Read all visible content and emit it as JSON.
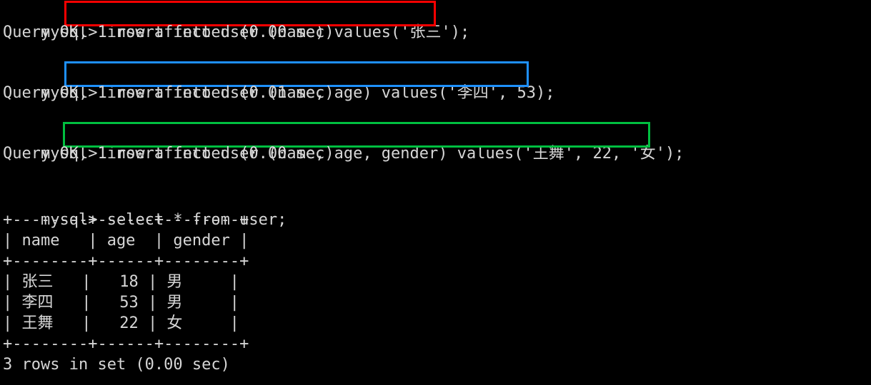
{
  "terminal": {
    "app": "mysql-client-terminal",
    "background_color": "#000000",
    "foreground_color": "#d6d6d6",
    "prompt": "mysql>"
  },
  "highlight_colors": {
    "red": "#fe0000",
    "blue": "#1e90ff",
    "green": "#00bf40"
  },
  "blocks": [
    {
      "id": "insert-name-only",
      "prompt": "mysql> ",
      "statement": "insert into user (name) values('张三');",
      "highlight": "red",
      "result": "Query OK, 1 row affected (0.00 sec)"
    },
    {
      "id": "insert-name-age",
      "prompt": "mysql> ",
      "statement": "insert into user (name, age) values('李四', 53);",
      "highlight": "blue",
      "result": "Query OK, 1 row affected (0.01 sec)"
    },
    {
      "id": "insert-name-age-gender",
      "prompt": "mysql> ",
      "statement": "insert into user (name, age, gender) values('王舞', 22, '女');",
      "highlight": "green",
      "result": "Query OK, 1 row affected (0.00 sec)"
    }
  ],
  "select_block": {
    "id": "select-all-user",
    "prompt": "mysql> ",
    "statement": "select * from user;",
    "rule_top": "+--------+------+--------+",
    "header_row": "| name   | age  | gender |",
    "rule_mid": "+--------+------+--------+",
    "rule_bottom": "+--------+------+--------+",
    "data_rows": [
      "| 张三   |   18 | 男     |",
      "| 李四   |   53 | 男     |",
      "| 王舞   |   22 | 女     |"
    ],
    "footer": "3 rows in set (0.00 sec)"
  },
  "table_data": {
    "columns": [
      "name",
      "age",
      "gender"
    ],
    "rows": [
      [
        "张三",
        "18",
        "男"
      ],
      [
        "李四",
        "53",
        "男"
      ],
      [
        "王舞",
        "22",
        "女"
      ]
    ],
    "row_count": 3,
    "elapsed": "0.00 sec"
  }
}
